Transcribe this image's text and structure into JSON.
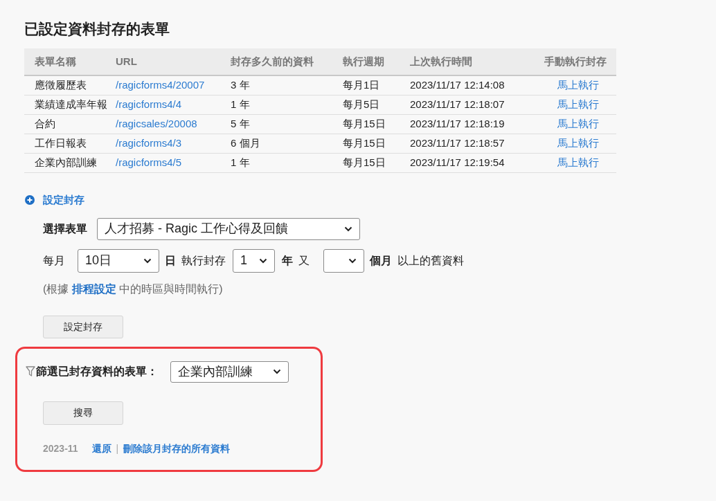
{
  "title": "已設定資料封存的表單",
  "table": {
    "columns": [
      "表單名稱",
      "URL",
      "封存多久前的資料",
      "執行週期",
      "上次執行時間",
      "手動執行封存"
    ],
    "rows": [
      {
        "name": "應徵履歷表",
        "url": "/ragicforms4/20007",
        "age": "3 年",
        "cycle": "每月1日",
        "last_run": "2023/11/17 12:14:08",
        "action": "馬上執行"
      },
      {
        "name": "業績達成率年報",
        "url": "/ragicforms4/4",
        "age": "1 年",
        "cycle": "每月5日",
        "last_run": "2023/11/17 12:18:07",
        "action": "馬上執行"
      },
      {
        "name": "合約",
        "url": "/ragicsales/20008",
        "age": "5 年",
        "cycle": "每月15日",
        "last_run": "2023/11/17 12:18:19",
        "action": "馬上執行"
      },
      {
        "name": "工作日報表",
        "url": "/ragicforms4/3",
        "age": "6 個月",
        "cycle": "每月15日",
        "last_run": "2023/11/17 12:18:57",
        "action": "馬上執行"
      },
      {
        "name": "企業內部訓練",
        "url": "/ragicforms4/5",
        "age": "1 年",
        "cycle": "每月15日",
        "last_run": "2023/11/17 12:19:54",
        "action": "馬上執行"
      }
    ]
  },
  "setup": {
    "link": "設定封存",
    "form_label": "選擇表單",
    "form_select": "人才招募 - Ragic 工作心得及回饋",
    "monthly_label": "每月",
    "day_select": "10日",
    "day_suffix": "日",
    "exec_label": "執行封存",
    "year_select": "1",
    "year_suffix": "年",
    "and_label": "又",
    "month_suffix": "個月",
    "tail": "以上的舊資料",
    "note": {
      "before": "(根據",
      "link": "排程設定",
      "after": "中的時區與時間執行)"
    },
    "button": "設定封存"
  },
  "filter": {
    "label": "篩選已封存資料的表單：",
    "select": "企業內部訓練",
    "button": "搜尋",
    "month": "2023-11",
    "restore": "還原",
    "separator": "|",
    "delete": "刪除該月封存的所有資料"
  }
}
